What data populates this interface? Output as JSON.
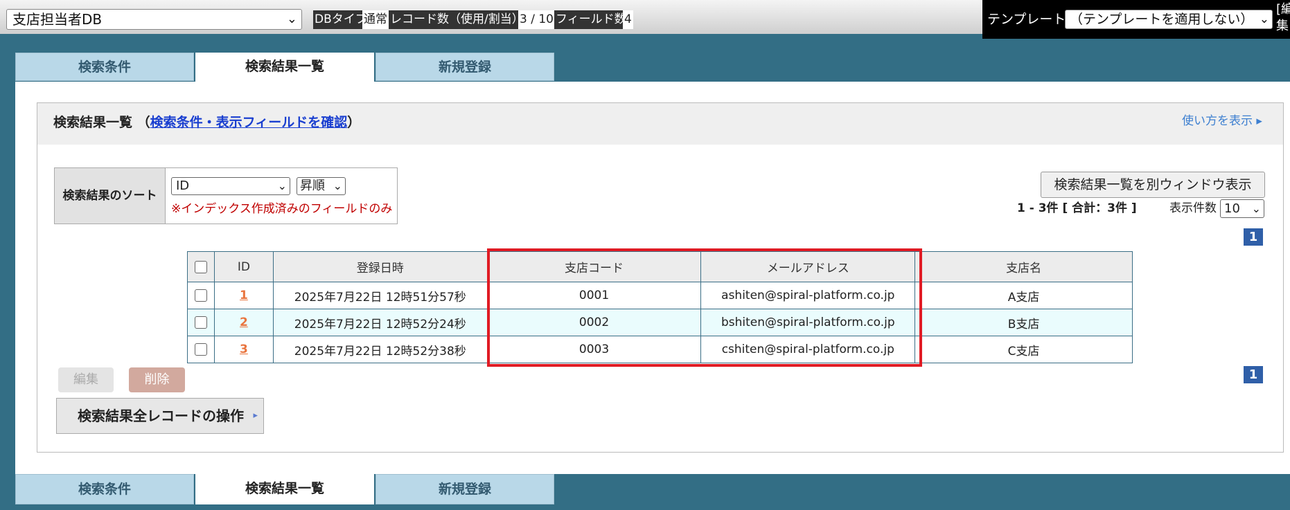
{
  "topbar": {
    "db_select_value": "支店担当者DB",
    "db_type_label": "DBタイプ",
    "db_type_value": "通常",
    "record_count_label": "レコード数（使用/割当）",
    "record_count_value": "3 / 10",
    "field_count_label": "フィールド数",
    "field_count_value": "4",
    "template_label": "テンプレート",
    "template_select_value": "（テンプレートを適用しない）",
    "template_edit_text": "[編集"
  },
  "tabs": [
    {
      "label": "検索条件",
      "active": false
    },
    {
      "label": "検索結果一覧",
      "active": true
    },
    {
      "label": "新規登録",
      "active": false
    }
  ],
  "panel": {
    "title": "検索結果一覧",
    "paren_open": "（",
    "title_link": "検索条件・表示フィールドを確認",
    "paren_close": "）",
    "help_link": "使い方を表示 ▸"
  },
  "sort": {
    "label": "検索結果のソート",
    "field_value": "ID",
    "order_value": "昇順",
    "note": "※インデックス作成済みのフィールドのみ"
  },
  "controls": {
    "open_window_label": "検索結果一覧を別ウィンドウ表示",
    "count_text": "1 - 3件 [ 合計：3件 ]",
    "per_page_label": "表示件数",
    "per_page_value": "10",
    "page_number": "1"
  },
  "table": {
    "columns": [
      "ID",
      "登録日時",
      "支店コード",
      "メールアドレス",
      "支店名"
    ],
    "rows": [
      {
        "id": "1",
        "registered": "2025年7月22日 12時51分57秒",
        "branch_code": "0001",
        "email": "ashiten@spiral-platform.co.jp",
        "branch_name": "A支店"
      },
      {
        "id": "2",
        "registered": "2025年7月22日 12時52分24秒",
        "branch_code": "0002",
        "email": "bshiten@spiral-platform.co.jp",
        "branch_name": "B支店"
      },
      {
        "id": "3",
        "registered": "2025年7月22日 12時52分38秒",
        "branch_code": "0003",
        "email": "cshiten@spiral-platform.co.jp",
        "branch_name": "C支店"
      }
    ]
  },
  "actions": {
    "edit_label": "編集",
    "delete_label": "削除",
    "all_ops_label": "検索結果全レコードの操作",
    "all_ops_arrow": "▸"
  },
  "colors": {
    "background": "#336e85",
    "highlight": "#e01b24",
    "link": "#1a3fd0",
    "id_link": "#e9753f",
    "page_badge": "#2f5fa8"
  }
}
